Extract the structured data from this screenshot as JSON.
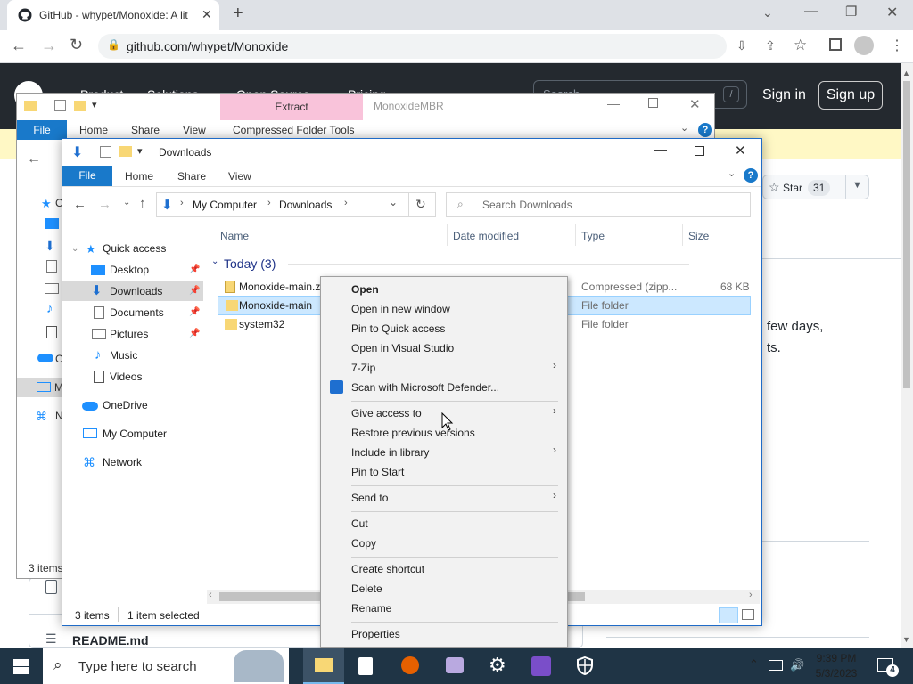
{
  "browser": {
    "tab_title": "GitHub - whypet/Monoxide: A lit",
    "url": "github.com/whypet/Monoxide"
  },
  "github": {
    "sign_in": "Sign in",
    "sign_up": "Sign up",
    "star_label": "Star",
    "star_count": "31",
    "text_fragment_1": "few days,",
    "text_fragment_2": "ts.",
    "readme_label": "README.md",
    "header_frag_1": "Product",
    "header_frag_2": "Solutions",
    "header_frag_3": "Open Source",
    "header_frag_4": "Pricing",
    "search_placeholder": "Search",
    "search_shortcut": "/"
  },
  "back_explorer": {
    "tool_tab": "Extract",
    "window_title": "MonoxideMBR",
    "ribbon_tabs": [
      "File",
      "Home",
      "Share",
      "View",
      "Compressed Folder Tools"
    ],
    "status": "3 items",
    "sidebar_frag": [
      "C",
      "C",
      "M",
      "N"
    ]
  },
  "explorer": {
    "title": "Downloads",
    "ribbon_tabs": [
      "File",
      "Home",
      "Share",
      "View"
    ],
    "breadcrumb": [
      "My Computer",
      "Downloads"
    ],
    "search_placeholder": "Search Downloads",
    "columns": [
      "Name",
      "Date modified",
      "Type",
      "Size"
    ],
    "group_header": "Today (3)",
    "files": [
      {
        "name": "Monoxide-main.zip",
        "type": "Compressed (zipp...",
        "size": "68 KB"
      },
      {
        "name": "Monoxide-main",
        "type": "File folder",
        "size": ""
      },
      {
        "name": "system32",
        "type": "File folder",
        "size": ""
      }
    ],
    "sidebar": {
      "quick_access": "Quick access",
      "items": [
        "Desktop",
        "Downloads",
        "Documents",
        "Pictures",
        "Music",
        "Videos"
      ],
      "onedrive": "OneDrive",
      "my_computer": "My Computer",
      "network": "Network"
    },
    "status_items": "3 items",
    "status_selected": "1 item selected"
  },
  "context_menu": {
    "items": [
      "Open",
      "Open in new window",
      "Pin to Quick access",
      "Open in Visual Studio",
      "7-Zip",
      "Scan with Microsoft Defender...",
      "Give access to",
      "Restore previous versions",
      "Include in library",
      "Pin to Start",
      "Send to",
      "Cut",
      "Copy",
      "Create shortcut",
      "Delete",
      "Rename",
      "Properties"
    ]
  },
  "taskbar": {
    "search_placeholder": "Type here to search",
    "time": "9:39 PM",
    "date": "5/3/2023",
    "notification_count": "4"
  },
  "colors": {
    "accent": "#1f6bc7",
    "ribbon_file": "#1979ca",
    "selection": "#cce8ff",
    "taskbar": "#1f3445"
  }
}
